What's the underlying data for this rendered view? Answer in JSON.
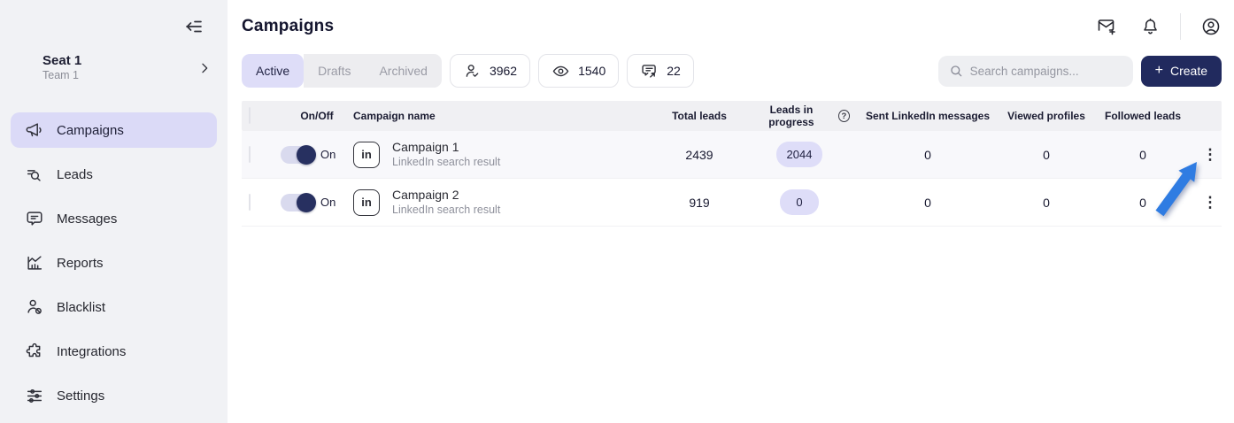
{
  "sidebar": {
    "seat": {
      "title": "Seat 1",
      "subtitle": "Team 1"
    },
    "items": [
      {
        "label": "Campaigns",
        "icon": "megaphone-icon",
        "active": true
      },
      {
        "label": "Leads",
        "icon": "leads-search-icon",
        "active": false
      },
      {
        "label": "Messages",
        "icon": "chat-bubble-icon",
        "active": false
      },
      {
        "label": "Reports",
        "icon": "chart-report-icon",
        "active": false
      },
      {
        "label": "Blacklist",
        "icon": "user-block-icon",
        "active": false
      },
      {
        "label": "Integrations",
        "icon": "puzzle-icon",
        "active": false
      },
      {
        "label": "Settings",
        "icon": "sliders-icon",
        "active": false
      }
    ]
  },
  "header": {
    "title": "Campaigns",
    "icons": [
      "mail-plus-icon",
      "bell-icon",
      "avatar-icon"
    ]
  },
  "toolbar": {
    "tabs": [
      {
        "label": "Active",
        "active": true
      },
      {
        "label": "Drafts",
        "active": false
      },
      {
        "label": "Archived",
        "active": false
      }
    ],
    "stats": [
      {
        "icon": "person-check-icon",
        "value": "3962"
      },
      {
        "icon": "eye-icon",
        "value": "1540"
      },
      {
        "icon": "chat-arrow-icon",
        "value": "22"
      }
    ],
    "search_placeholder": "Search campaigns...",
    "create_plus": "+",
    "create_label": "Create"
  },
  "table": {
    "headers": {
      "on_off": "On/Off",
      "campaign_name": "Campaign name",
      "total_leads": "Total leads",
      "leads_in_progress": "Leads in progress",
      "leads_in_progress_help": "?",
      "sent_messages": "Sent LinkedIn messages",
      "viewed_profiles": "Viewed profiles",
      "followed_leads": "Followed leads"
    },
    "linkedin_glyph": "in",
    "kebab_glyph": "⋮",
    "rows": [
      {
        "toggle_state": "On",
        "name": "Campaign 1",
        "subtitle": "LinkedIn search result",
        "total_leads": "2439",
        "leads_in_progress": "2044",
        "sent_messages": "0",
        "viewed_profiles": "0",
        "followed_leads": "0"
      },
      {
        "toggle_state": "On",
        "name": "Campaign 2",
        "subtitle": "LinkedIn search result",
        "total_leads": "919",
        "leads_in_progress": "0",
        "sent_messages": "0",
        "viewed_profiles": "0",
        "followed_leads": "0"
      }
    ]
  },
  "annotation": {
    "type": "arrow",
    "color": "#2f7ce2",
    "points_at": "row-1-kebab-menu"
  },
  "colors": {
    "sidebar_bg": "#f1f2f5",
    "active_pill": "#dbdaf7",
    "accent_lavender": "#deddf8",
    "navy": "#212a5e",
    "arrow_blue": "#2f7ce2",
    "table_header_bg": "#f0f0f3",
    "row_tint": "#f8f8fb"
  }
}
